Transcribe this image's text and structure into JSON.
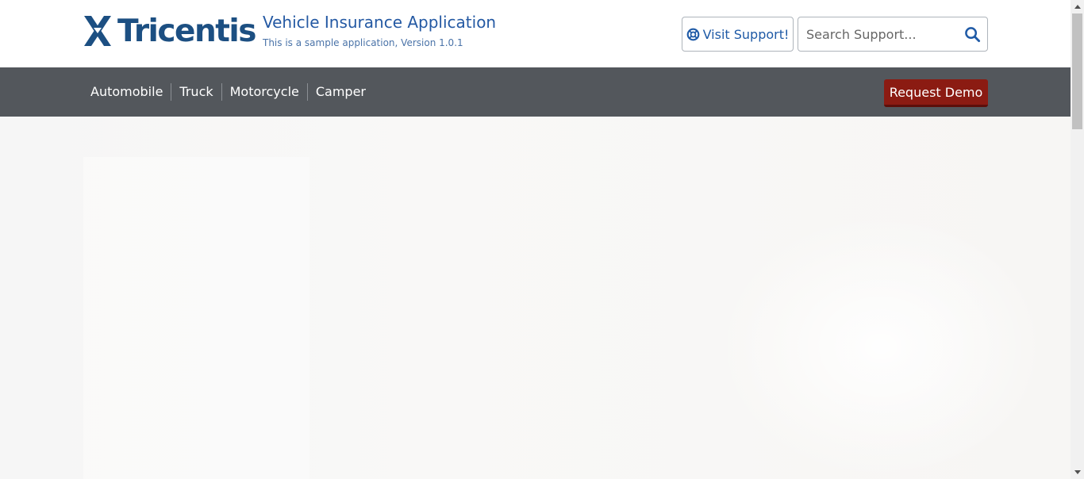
{
  "header": {
    "logo_text": "Tricentis",
    "app_title": "Vehicle Insurance Application",
    "app_subtitle": "This is a sample application, Version 1.0.1",
    "support_button_label": "Visit Support!",
    "support_icon": "lifebuoy-icon",
    "search": {
      "placeholder": "Search Support...",
      "value": "",
      "icon": "search-icon"
    }
  },
  "nav": {
    "items": [
      {
        "label": "Automobile"
      },
      {
        "label": "Truck"
      },
      {
        "label": "Motorcycle"
      },
      {
        "label": "Camper"
      }
    ],
    "demo_button_label": "Request Demo"
  },
  "colors": {
    "brand_blue": "#1c4f82",
    "link_blue": "#2459a3",
    "navbar_gray": "#53575c",
    "demo_red": "#8b1b12"
  }
}
